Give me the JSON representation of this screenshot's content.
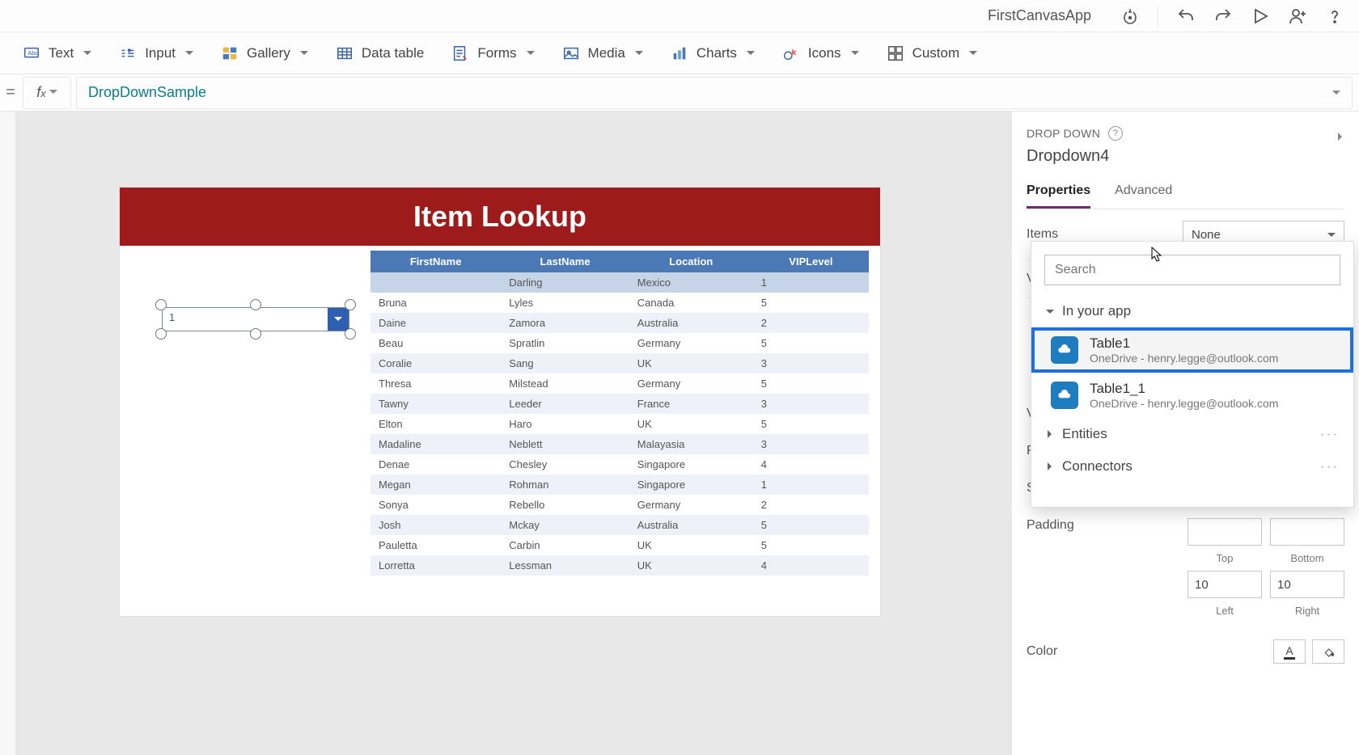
{
  "app": {
    "title": "FirstCanvasApp"
  },
  "ribbon": {
    "text": "Text",
    "input": "Input",
    "gallery": "Gallery",
    "data_table": "Data table",
    "forms": "Forms",
    "media": "Media",
    "charts": "Charts",
    "icons": "Icons",
    "custom": "Custom"
  },
  "formula": {
    "value": "DropDownSample"
  },
  "canvas_app": {
    "header": "Item Lookup",
    "dropdown_value": "1",
    "columns": [
      "FirstName",
      "LastName",
      "Location",
      "VIPLevel"
    ],
    "rows": [
      [
        "",
        "Darling",
        "Mexico",
        "1"
      ],
      [
        "Bruna",
        "Lyles",
        "Canada",
        "5"
      ],
      [
        "Daine",
        "Zamora",
        "Australia",
        "2"
      ],
      [
        "Beau",
        "Spratlin",
        "Germany",
        "5"
      ],
      [
        "Coralie",
        "Sang",
        "UK",
        "3"
      ],
      [
        "Thresa",
        "Milstead",
        "Germany",
        "5"
      ],
      [
        "Tawny",
        "Leeder",
        "France",
        "3"
      ],
      [
        "Elton",
        "Haro",
        "UK",
        "5"
      ],
      [
        "Madaline",
        "Neblett",
        "Malayasia",
        "3"
      ],
      [
        "Denae",
        "Chesley",
        "Singapore",
        "4"
      ],
      [
        "Megan",
        "Rohman",
        "Singapore",
        "1"
      ],
      [
        "Sonya",
        "Rebello",
        "Germany",
        "2"
      ],
      [
        "Josh",
        "Mckay",
        "Australia",
        "5"
      ],
      [
        "Pauletta",
        "Carbin",
        "UK",
        "5"
      ],
      [
        "Lorretta",
        "Lessman",
        "UK",
        "4"
      ]
    ]
  },
  "props": {
    "type_label": "DROP DOWN",
    "control_name": "Dropdown4",
    "tabs": {
      "properties": "Properties",
      "advanced": "Advanced"
    },
    "rows": {
      "items": "Items",
      "items_value": "None",
      "visible_prefix": "Vi",
      "position_prefix": "Po",
      "size_prefix": "Siz",
      "padding": "Padding",
      "color": "Color",
      "va_prefix": "Va"
    },
    "padding": {
      "top_label": "Top",
      "bottom_label": "Bottom",
      "left_label": "Left",
      "right_label": "Right",
      "left_value": "10",
      "right_value": "10"
    }
  },
  "popup": {
    "search_placeholder": "Search",
    "in_your_app": "In your app",
    "entities": "Entities",
    "connectors": "Connectors",
    "items": [
      {
        "name": "Table1",
        "sub": "OneDrive - henry.legge@outlook.com"
      },
      {
        "name": "Table1_1",
        "sub": "OneDrive - henry.legge@outlook.com"
      }
    ]
  }
}
